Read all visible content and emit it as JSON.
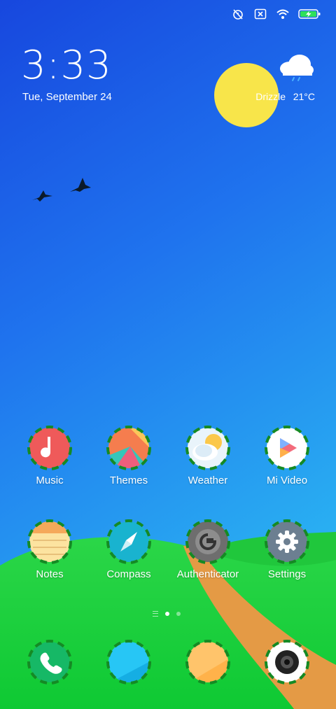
{
  "status_bar": {
    "icons": [
      "alarm-off-icon",
      "sim-off-icon",
      "wifi-icon",
      "battery-charging-icon"
    ]
  },
  "lockclock": {
    "time": "3:33",
    "date": "Tue, September 24"
  },
  "weather_widget": {
    "condition": "Drizzle",
    "temperature": "21°C",
    "icon": "cloud-drizzle-icon"
  },
  "apps_row1": [
    {
      "label": "Music",
      "icon": "music-icon"
    },
    {
      "label": "Themes",
      "icon": "themes-icon"
    },
    {
      "label": "Weather",
      "icon": "weather-icon"
    },
    {
      "label": "Mi Video",
      "icon": "video-play-icon"
    }
  ],
  "apps_row2": [
    {
      "label": "Notes",
      "icon": "notes-icon"
    },
    {
      "label": "Compass",
      "icon": "compass-icon"
    },
    {
      "label": "Authenticator",
      "icon": "authenticator-icon"
    },
    {
      "label": "Settings",
      "icon": "settings-gear-icon"
    }
  ],
  "dock": [
    {
      "icon": "phone-icon"
    },
    {
      "icon": "messages-icon"
    },
    {
      "icon": "gallery-icon"
    },
    {
      "icon": "camera-icon"
    }
  ],
  "page_indicator": {
    "pages": 2,
    "active": 0
  },
  "colors": {
    "sky_top": "#1a4fe0",
    "sky_bottom": "#2aa8f0",
    "sun": "#f7e44b",
    "hill": "#1fd23d",
    "path": "#e29a3f",
    "icon_ring": "#1a9c2b"
  }
}
